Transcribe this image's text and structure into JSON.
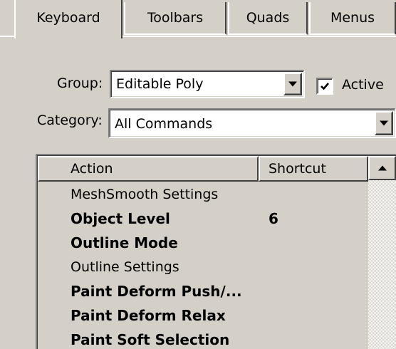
{
  "tabs": [
    {
      "label": "Keyboard",
      "active": true
    },
    {
      "label": "Toolbars",
      "active": false
    },
    {
      "label": "Quads",
      "active": false
    },
    {
      "label": "Menus",
      "active": false
    }
  ],
  "group": {
    "label": "Group:",
    "value": "Editable Poly"
  },
  "active_checkbox": {
    "label": "Active",
    "checked": true
  },
  "category": {
    "label": "Category:",
    "value": "All Commands"
  },
  "list": {
    "columns": {
      "action": "Action",
      "shortcut": "Shortcut"
    },
    "rows": [
      {
        "action": "MeshSmooth Settings",
        "shortcut": "",
        "bold": false
      },
      {
        "action": "Object Level",
        "shortcut": "6",
        "bold": true
      },
      {
        "action": "Outline Mode",
        "shortcut": "",
        "bold": true
      },
      {
        "action": "Outline Settings",
        "shortcut": "",
        "bold": false
      },
      {
        "action": "Paint Deform Push/...",
        "shortcut": "",
        "bold": true
      },
      {
        "action": "Paint Deform Relax",
        "shortcut": "",
        "bold": true
      },
      {
        "action": "Paint Soft Selection",
        "shortcut": "",
        "bold": true
      }
    ]
  },
  "icons": {
    "dropdown": "chevron-down-icon",
    "check": "check-icon",
    "scroll_up": "scroll-up-arrow-icon"
  },
  "colors": {
    "dialog_bg": "#d4d0c8",
    "field_bg": "#ffffff"
  }
}
